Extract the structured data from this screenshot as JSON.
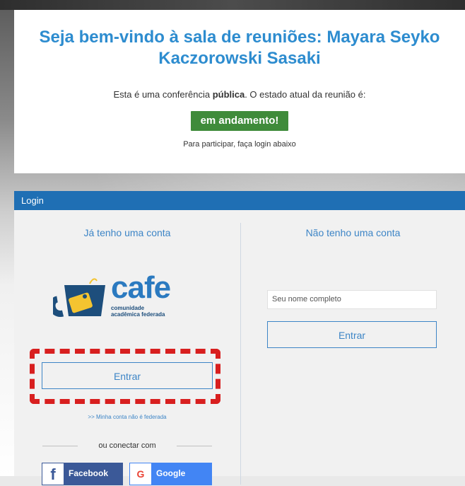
{
  "welcome": {
    "title_prefix": "Seja bem-vindo à sala de reuniões: ",
    "room_name": "Mayara Seyko Kaczorowski Sasaki",
    "status_text_before": "Esta é uma conferência ",
    "status_text_bold": "pública",
    "status_text_after": ". O estado atual da reunião é:",
    "status_badge": "em andamento!",
    "login_hint": "Para participar, faça login abaixo"
  },
  "login": {
    "header_title": "Login",
    "left_column_title": "Já tenho uma conta",
    "right_column_title": "Não tenho uma conta",
    "cafe_logo": {
      "brand_text": "cafe",
      "subtitle_line1": "comunidade",
      "subtitle_line2": "acadêmica federada"
    },
    "left_enter_button": "Entrar",
    "non_federated_link": ">> Minha conta não é federada",
    "separator_text": "ou conectar com",
    "facebook_button": "Facebook",
    "google_button": "Google",
    "name_input_placeholder": "Seu nome completo",
    "right_enter_button": "Entrar"
  },
  "colors": {
    "accent_blue": "#2d8ccf",
    "header_blue": "#1f6fb4",
    "status_green": "#3f8b3a",
    "highlight_red": "#d81f1f",
    "facebook_blue": "#3b5998",
    "google_blue": "#4285f4"
  },
  "icons": {
    "cafe_mug": "mug-icon",
    "facebook": "facebook-icon",
    "google": "google-icon"
  }
}
